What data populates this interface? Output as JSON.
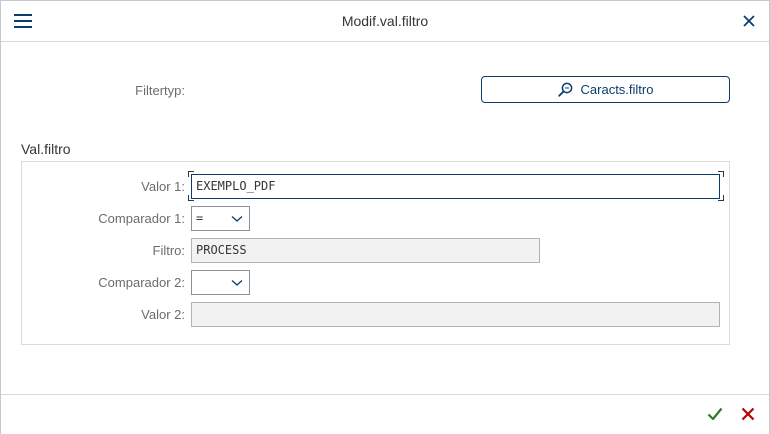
{
  "dialog": {
    "title": "Modif.val.filtro"
  },
  "filter_type": {
    "label": "Filtertyp:",
    "button_label": "Caracts.filtro"
  },
  "section": {
    "title": "Val.filtro"
  },
  "fields": {
    "valor1": {
      "label": "Valor 1:",
      "value": "EXEMPLO_PDF"
    },
    "comparador1": {
      "label": "Comparador 1:",
      "value": "="
    },
    "filtro": {
      "label": "Filtro:",
      "value": "PROCESS"
    },
    "comparador2": {
      "label": "Comparador 2:",
      "value": ""
    },
    "valor2": {
      "label": "Valor 2:",
      "value": ""
    }
  },
  "icons": {
    "menu": "hamburger-menu-icon",
    "close": "close-icon",
    "search": "search-icon",
    "confirm": "checkmark-icon",
    "cancel": "cancel-icon"
  },
  "colors": {
    "brand": "#0a3d6e",
    "confirm": "#2b7d2b",
    "cancel": "#bb0000",
    "readonly_bg": "#f2f2f2"
  }
}
